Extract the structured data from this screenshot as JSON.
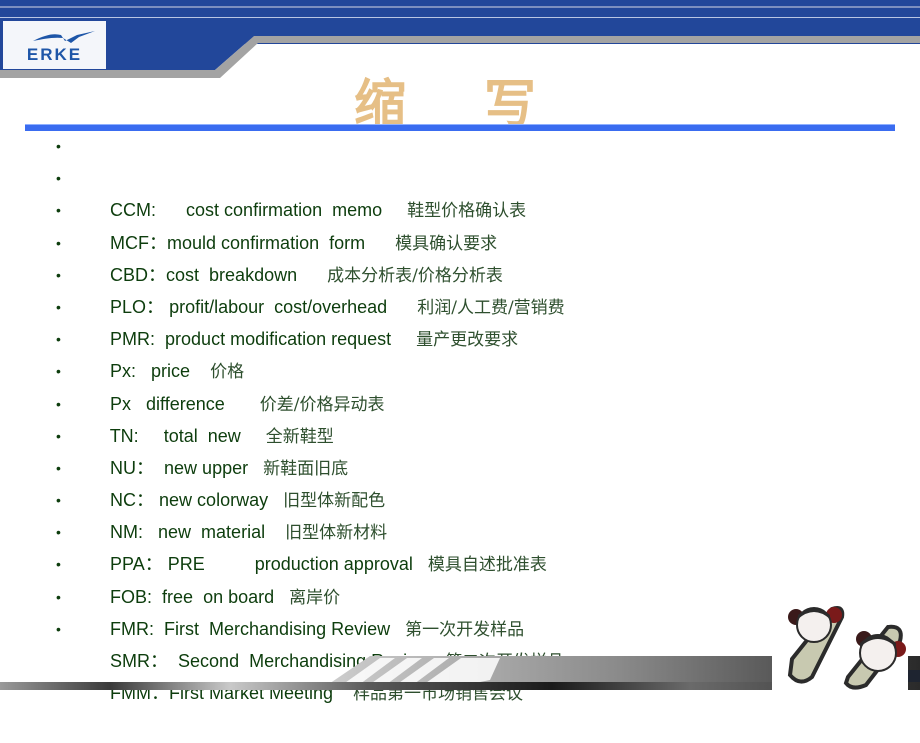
{
  "header": {
    "logo_text": "ERKE",
    "title": "缩 写"
  },
  "colors": {
    "header_blue": "#22479a",
    "rule_blue": "#3a6cf0",
    "title_tan": "#e6bf86",
    "text_green": "#0d3d0d"
  },
  "items": [
    {
      "bullet": "•",
      "abbr": "CCM:",
      "gap1": "      ",
      "eng": "cost confirmation  memo",
      "gap2": "     ",
      "zh": "鞋型价格确认表"
    },
    {
      "bullet": "•",
      "abbr": "MCF：",
      "gap1": "",
      "eng": "mould confirmation  form",
      "gap2": "      ",
      "zh": "模具确认要求"
    },
    {
      "bullet": "•",
      "abbr": "CBD：",
      "gap1": "",
      "eng": "cost  breakdown",
      "gap2": "      ",
      "zh": "成本分析表/价格分析表"
    },
    {
      "bullet": "•",
      "abbr": "PLO：",
      "gap1": " ",
      "eng": "profit/labour  cost/overhead",
      "gap2": "      ",
      "zh": "利润/人工费/营销费"
    },
    {
      "bullet": "•",
      "abbr": "PMR:",
      "gap1": "  ",
      "eng": "product modification request",
      "gap2": "     ",
      "zh": "量产更改要求"
    },
    {
      "bullet": "•",
      "abbr": "Px:",
      "gap1": "   ",
      "eng": "price",
      "gap2": "    ",
      "zh": "价格"
    },
    {
      "bullet": "•",
      "abbr": "Px",
      "gap1": "   ",
      "eng": "difference",
      "gap2": "       ",
      "zh": "价差/价格异动表"
    },
    {
      "bullet": "•",
      "abbr": "TN:",
      "gap1": "     ",
      "eng": "total  new",
      "gap2": "     ",
      "zh": "全新鞋型"
    },
    {
      "bullet": "•",
      "abbr": "NU：",
      "gap1": "  ",
      "eng": "new upper",
      "gap2": "   ",
      "zh": "新鞋面旧底"
    },
    {
      "bullet": "•",
      "abbr": "NC：",
      "gap1": " ",
      "eng": "new colorway",
      "gap2": "   ",
      "zh": "旧型体新配色"
    },
    {
      "bullet": "•",
      "abbr": "NM:",
      "gap1": "   ",
      "eng": "new  material",
      "gap2": "    ",
      "zh": "旧型体新材料"
    },
    {
      "bullet": "•",
      "abbr": "PPA：",
      "gap1": " ",
      "eng": "PRE          production approval",
      "gap2": "   ",
      "zh": "模具自述批准表"
    },
    {
      "bullet": "•",
      "abbr": "FOB:",
      "gap1": "  ",
      "eng": "free  on board",
      "gap2": "   ",
      "zh": "离岸价"
    },
    {
      "bullet": "•",
      "abbr": "FMR:",
      "gap1": "  ",
      "eng": "First  Merchandising Review",
      "gap2": "   ",
      "zh": "第一次开发样品"
    },
    {
      "bullet": "•",
      "abbr": "SMR：",
      "gap1": "  ",
      "eng": "Second  Merchandising Review",
      "gap2": "   ",
      "zh": "第二次开发样品"
    },
    {
      "bullet": "•",
      "abbr": "FMM：",
      "gap1": "",
      "eng": "First Market Meeting",
      "gap2": "    ",
      "zh": "样品第一市场销售会议"
    }
  ],
  "decor": {
    "photo_subject": "panda-face slippers"
  }
}
